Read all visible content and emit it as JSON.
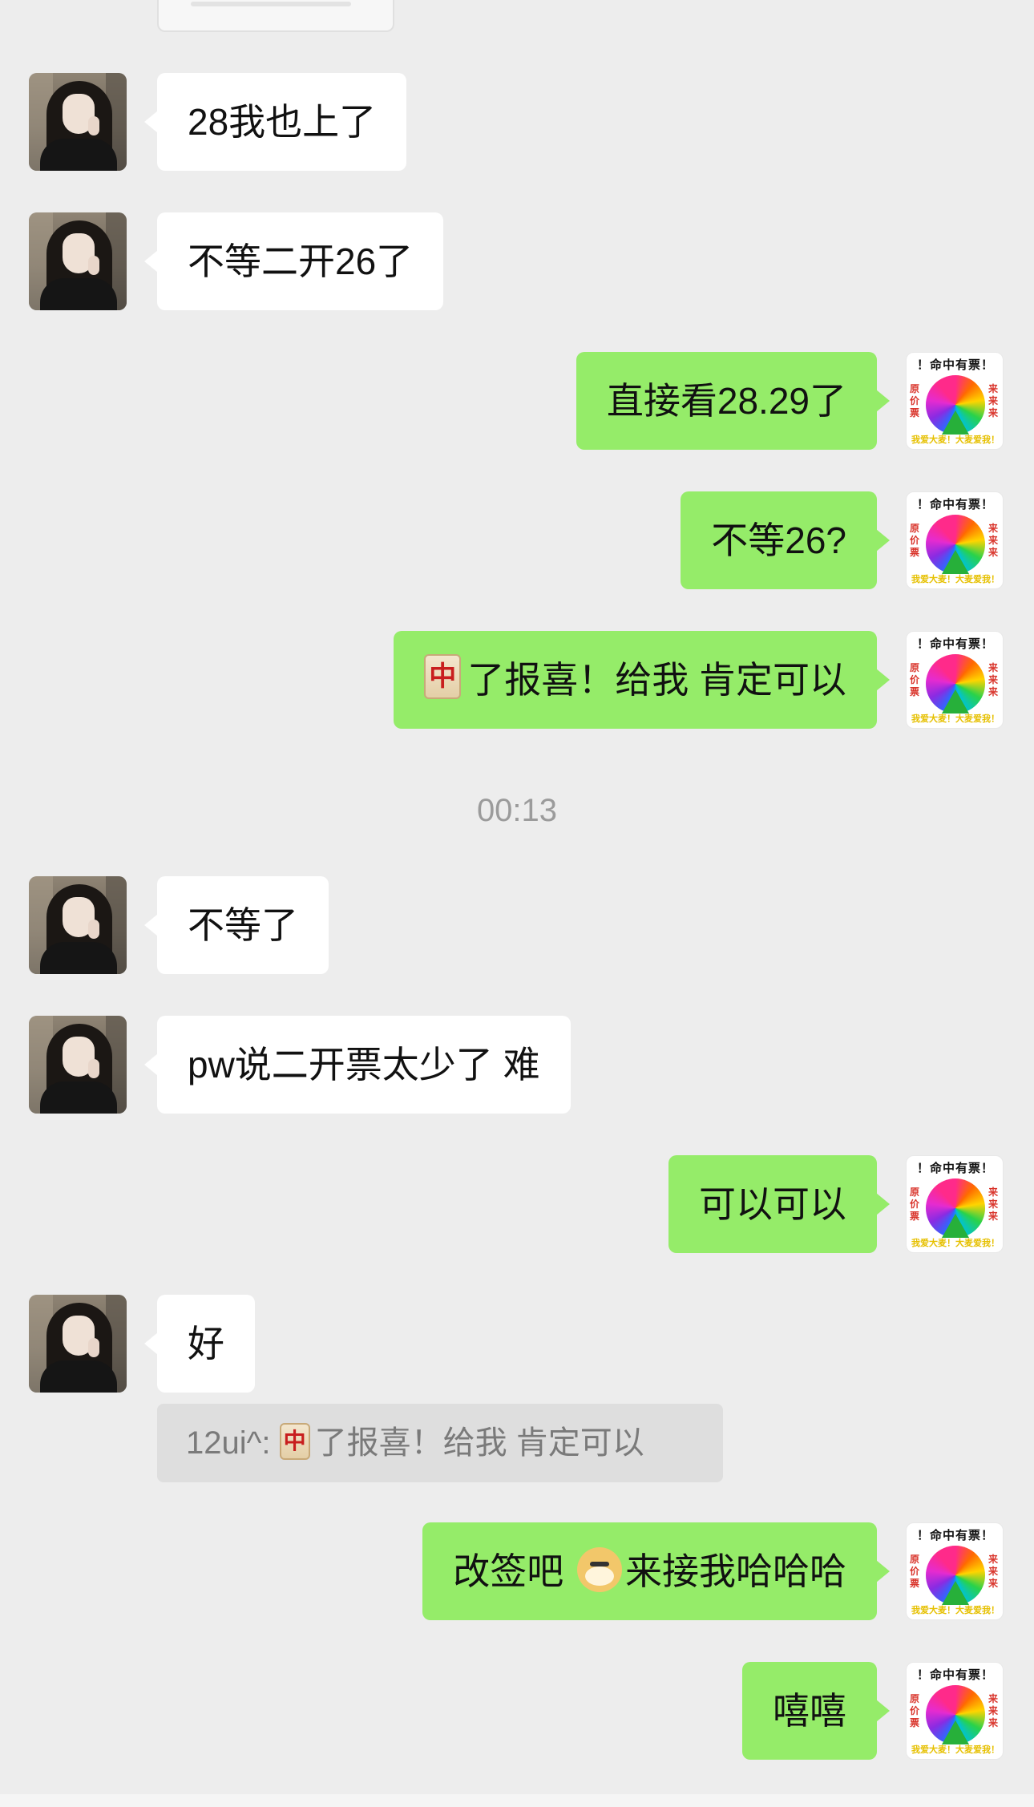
{
  "messages": [
    {
      "side": "in",
      "text": "28我也上了"
    },
    {
      "side": "in",
      "text": "不等二开26了"
    },
    {
      "side": "out",
      "text": "直接看28.29了"
    },
    {
      "side": "out",
      "text": "不等26?"
    },
    {
      "side": "out",
      "icon": "mahjong-zhong-icon",
      "text": "了报喜！给我 肯定可以"
    },
    {
      "side": "in",
      "text": "不等了"
    },
    {
      "side": "in",
      "text": "pw说二开票太少了 难"
    },
    {
      "side": "out",
      "text": "可以可以"
    },
    {
      "side": "in",
      "text": "好"
    },
    {
      "side": "out",
      "text_before": "改签吧",
      "icon": "doge-icon",
      "text_after": "来接我哈哈哈"
    },
    {
      "side": "out",
      "text": "嘻嘻"
    }
  ],
  "timestamp": "00:13",
  "quote": {
    "sender": "12ui^:",
    "icon": "mahjong-zhong-icon",
    "text": "了报喜！给我 肯定可以"
  },
  "self_avatar": {
    "top": "！命中有票！",
    "left": "原价票",
    "right": "来来来",
    "bottom": "我爱大麦！大麦爱我！"
  },
  "colors": {
    "background": "#ededed",
    "incoming_bubble": "#ffffff",
    "outgoing_bubble": "#95ec69",
    "timestamp_text": "#9b9b9b"
  }
}
